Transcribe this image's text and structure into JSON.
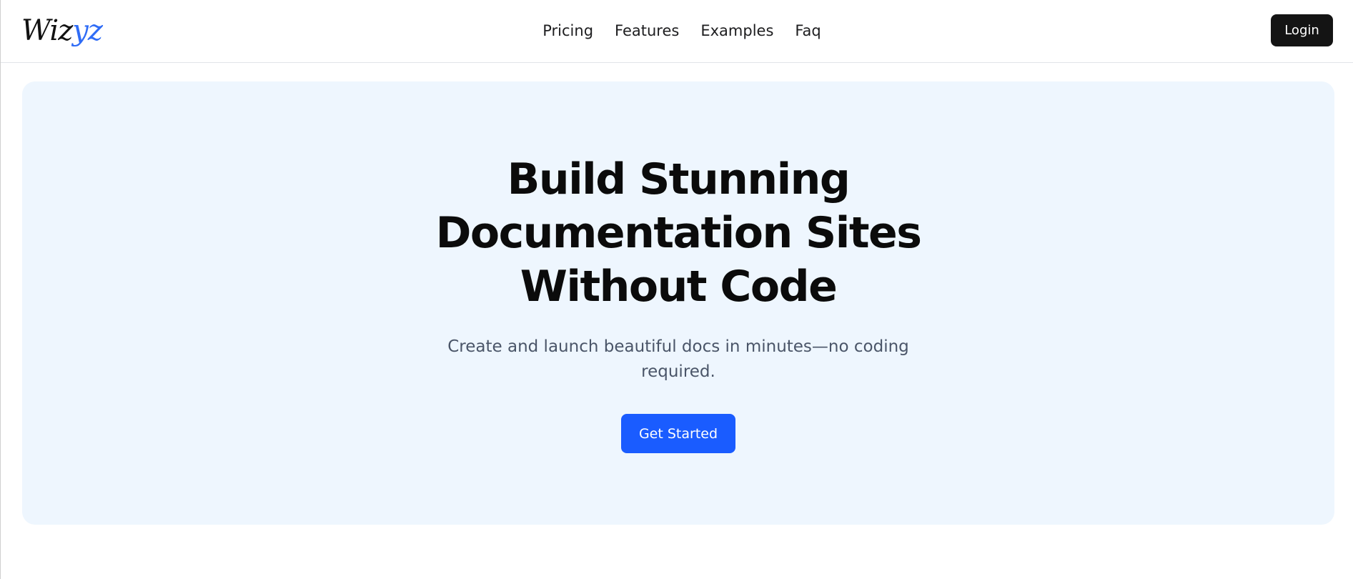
{
  "colors": {
    "accent": "#2f6cf6",
    "primary": "#1a5cff",
    "hero_bg": "#eef6fe",
    "login_bg": "#141414"
  },
  "header": {
    "logo_part_a": "Wiz",
    "logo_part_b": "yz",
    "nav": [
      {
        "label": "Pricing"
      },
      {
        "label": "Features"
      },
      {
        "label": "Examples"
      },
      {
        "label": "Faq"
      }
    ],
    "login_label": "Login"
  },
  "hero": {
    "title_lines": [
      "Build Stunning",
      "Documentation Sites",
      "Without Code"
    ],
    "subtitle": "Create and launch beautiful docs in minutes—no coding required.",
    "cta_label": "Get Started"
  }
}
